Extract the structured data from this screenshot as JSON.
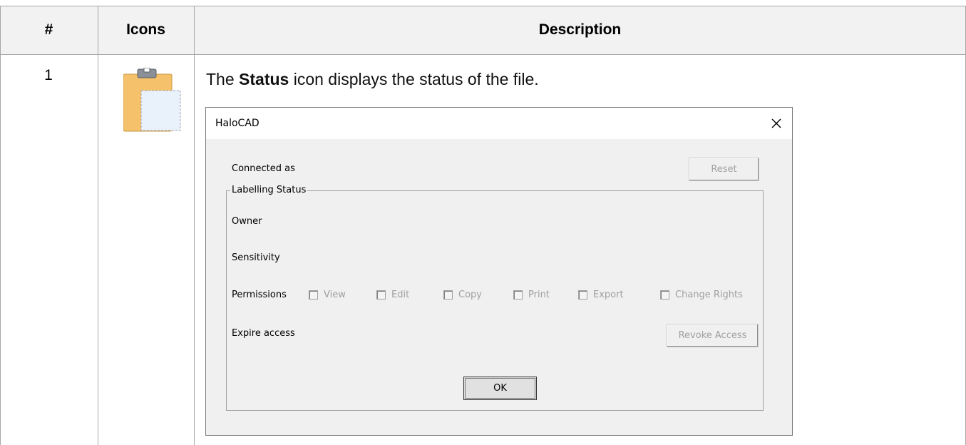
{
  "table": {
    "headers": {
      "num": "#",
      "icons": "Icons",
      "description": "Description"
    },
    "row": {
      "num": "1",
      "icon": "status-clipboard-icon",
      "desc_prefix": "The ",
      "desc_bold": "Status",
      "desc_suffix": " icon displays the status of the file."
    }
  },
  "dialog": {
    "title": "HaloCAD",
    "close_icon": "close-icon",
    "connected_as_label": "Connected as",
    "reset_label": "Reset",
    "group_label": "Labelling Status",
    "owner_label": "Owner",
    "sensitivity_label": "Sensitivity",
    "permissions_label": "Permissions",
    "permissions": [
      {
        "label": "View",
        "checked": false,
        "enabled": false
      },
      {
        "label": "Edit",
        "checked": false,
        "enabled": false
      },
      {
        "label": "Copy",
        "checked": false,
        "enabled": false
      },
      {
        "label": "Print",
        "checked": false,
        "enabled": false
      },
      {
        "label": "Export",
        "checked": false,
        "enabled": false
      },
      {
        "label": "Change Rights",
        "checked": false,
        "enabled": false
      }
    ],
    "expire_label": "Expire access",
    "revoke_label": "Revoke Access",
    "ok_label": "OK"
  },
  "colors": {
    "header_bg": "#f2f2f2",
    "border": "#a6a6a6",
    "dialog_bg": "#f0f0f0",
    "disabled_text": "#a0a0a0",
    "icon_orange": "#f5c26b"
  }
}
